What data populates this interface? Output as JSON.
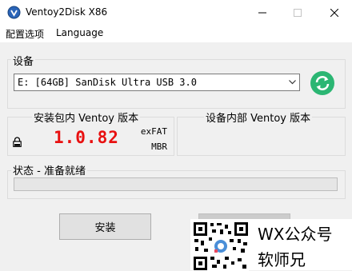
{
  "window": {
    "title": "Ventoy2Disk  X86",
    "controls": [
      "minimize",
      "maximize",
      "close"
    ]
  },
  "menu": {
    "items": [
      {
        "label": "配置选项"
      },
      {
        "label": "Language"
      }
    ]
  },
  "device_group": {
    "label": "设备",
    "selected_device": "E: [64GB] SanDisk Ultra USB 3.0",
    "refresh_icon": "refresh-icon",
    "refresh_color": "#2bb673"
  },
  "package_group": {
    "label": "安装包内 Ventoy 版本",
    "version": "1.0.82",
    "version_color": "#e81010",
    "filesystem": "exFAT",
    "partition_style": "MBR",
    "lock_icon": "lock-icon"
  },
  "device_version_group": {
    "label": "设备内部 Ventoy 版本",
    "version": ""
  },
  "status": {
    "label": "状态 - 准备就绪",
    "progress": 0
  },
  "buttons": {
    "install": "安装",
    "update": ""
  },
  "watermark": {
    "line1": "WX公众号",
    "line2": "软师兄"
  }
}
